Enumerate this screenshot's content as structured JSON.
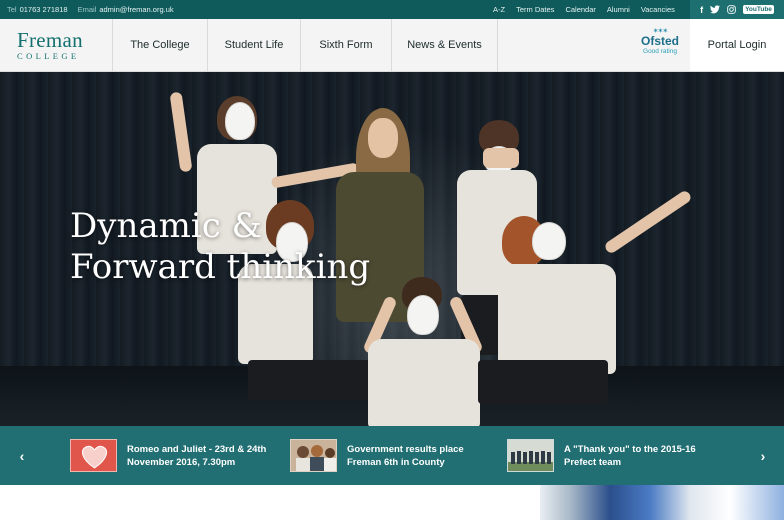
{
  "topbar": {
    "tel_label": "Tel",
    "tel": "01763 271818",
    "email_label": "Email",
    "email": "admin@freman.org.uk",
    "links": [
      "A-Z",
      "Term Dates",
      "Calendar",
      "Alumni",
      "Vacancies"
    ],
    "social": {
      "facebook": "f",
      "twitter": "t",
      "instagram": "instagram-icon",
      "youtube": "YouTube"
    }
  },
  "logo": {
    "name": "Freman",
    "sub": "COLLEGE"
  },
  "nav": {
    "items": [
      "The College",
      "Student Life",
      "Sixth Form",
      "News & Events"
    ],
    "portal": "Portal Login"
  },
  "ofsted": {
    "name": "Ofsted",
    "rating": "Good rating"
  },
  "hero": {
    "line1": "Dynamic &",
    "line2": "Forward thinking"
  },
  "news": {
    "prev": "‹",
    "next": "›",
    "items": [
      {
        "title": "Romeo and Juliet - 23rd & 24th November 2016, 7.30pm",
        "thumb": "heart-thumbnail"
      },
      {
        "title": "Government results place Freman 6th in County",
        "thumb": "students-thumbnail"
      },
      {
        "title": "A \"Thank you\" to the 2015-16 Prefect team",
        "thumb": "group-photo-thumbnail"
      }
    ]
  },
  "colors": {
    "brand_teal": "#0f5b5c",
    "strip_teal": "#106468",
    "logo_teal": "#13706f"
  }
}
